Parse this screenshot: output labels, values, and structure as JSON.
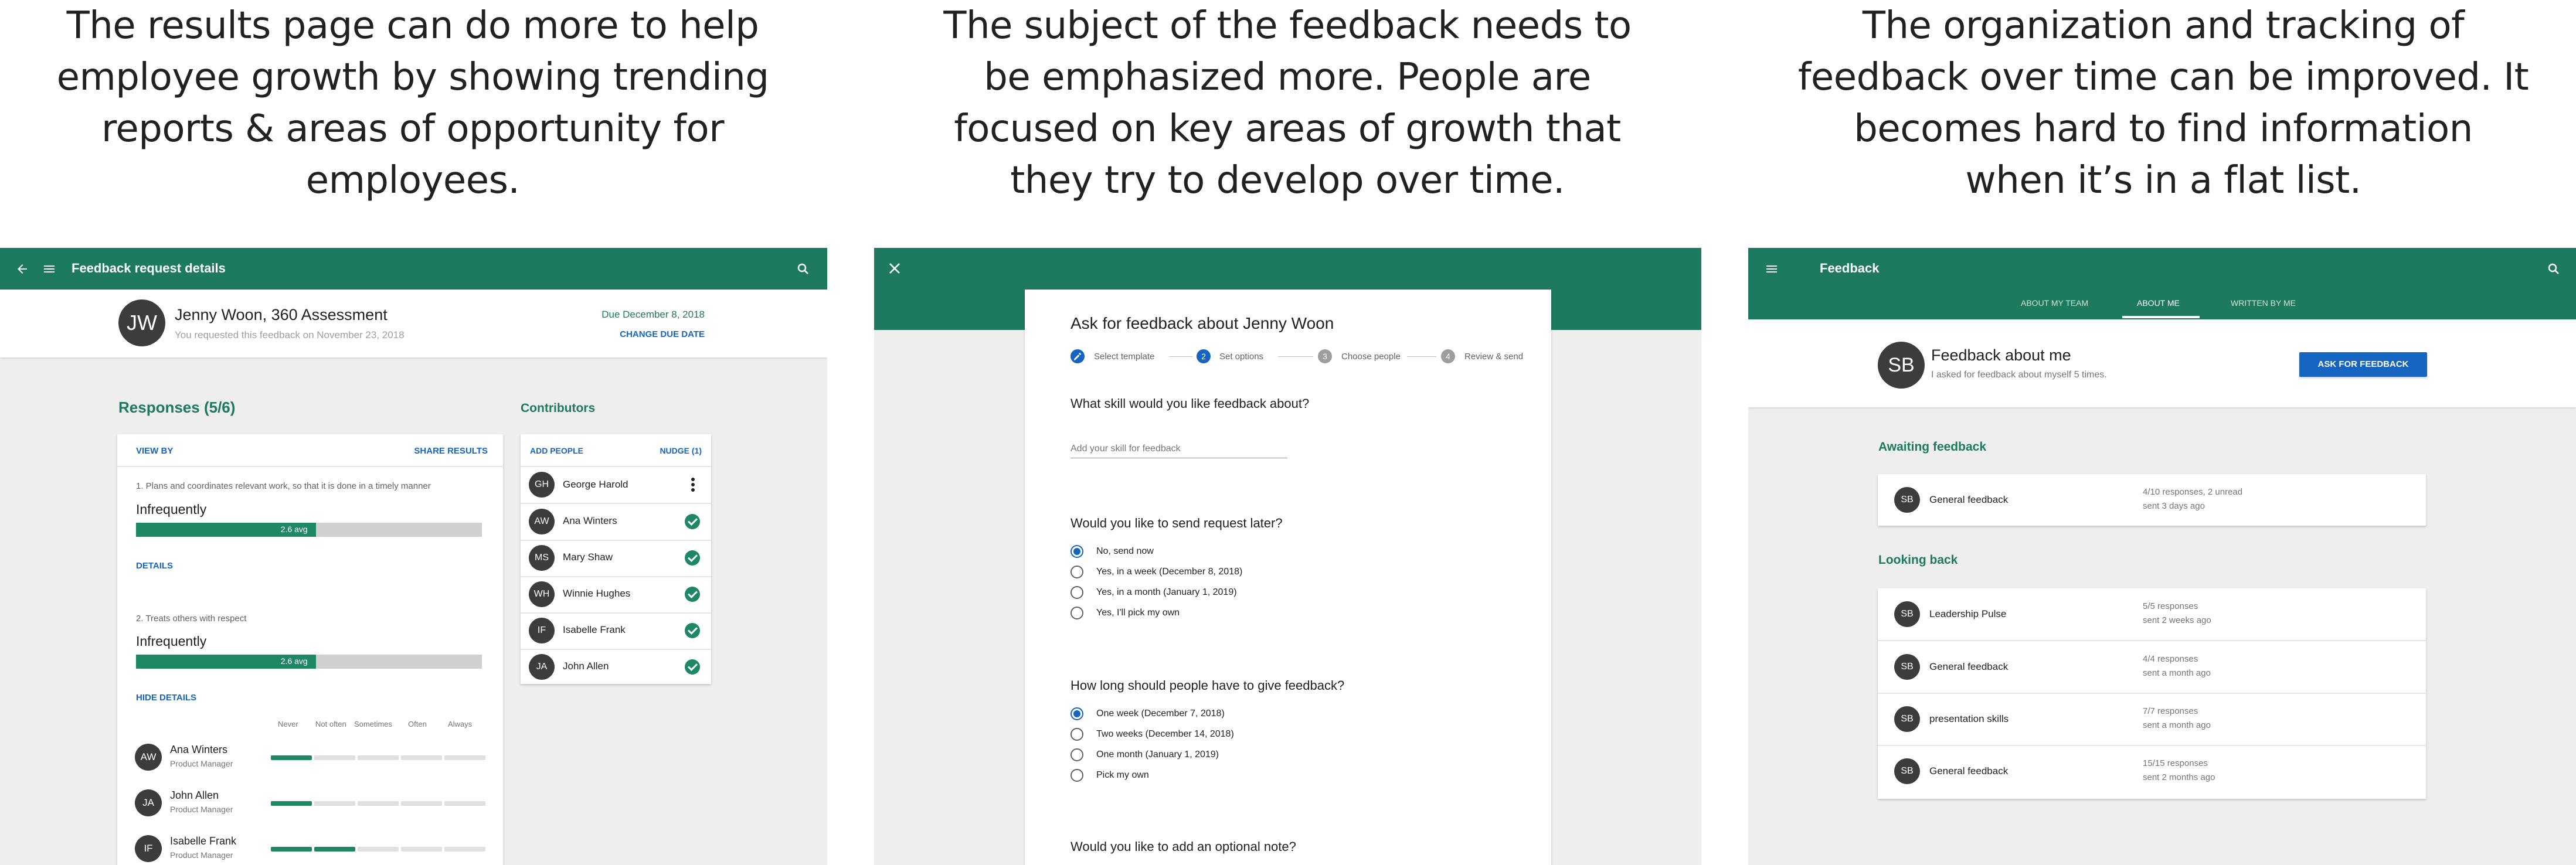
{
  "captions": [
    [
      "The results page can do more to help",
      "employee growth by showing trending",
      "reports & areas of opportunity for",
      "employees."
    ],
    [
      "The subject of the feedback needs to",
      "be emphasized more. People are",
      "focused on key areas of growth that",
      "they try to develop over time."
    ],
    [
      "The organization and tracking of",
      "feedback over time can be improved. It",
      "becomes hard to find information",
      "when it’s in a flat list."
    ]
  ],
  "colors": {
    "primary": "#1d7a5e",
    "accent_blue": "#1565c0",
    "bar_fill": "#1d8766",
    "bar_track": "#d0d0d0",
    "background": "#eeeeee"
  },
  "panel1": {
    "appbar_title": "Feedback request details",
    "icons": [
      "back-arrow-icon",
      "menu-icon",
      "search-icon",
      "more-vert-icon",
      "check-circle-icon"
    ],
    "header": {
      "initials": "JW",
      "title": "Jenny Woon, 360 Assessment",
      "subtitle": "You requested this feedback on November 23, 2018",
      "due": "Due December 8, 2018",
      "change_due": "CHANGE DUE DATE"
    },
    "responses_title": "Responses (5/6)",
    "view_by": "VIEW BY",
    "share_results": "SHARE RESULTS",
    "questions": [
      {
        "text": "1. Plans and coordinates relevant work, so that it is done in a timely manner",
        "rating": "Infrequently",
        "avg_label": "2.6 avg",
        "avg": 2.6,
        "link": "DETAILS"
      },
      {
        "text": "2. Treats others with respect",
        "rating": "Infrequently",
        "avg_label": "2.6 avg",
        "avg": 2.6,
        "link": "HIDE DETAILS"
      }
    ],
    "scale_labels": [
      "Never",
      "Not often",
      "Sometimes",
      "Often",
      "Always"
    ],
    "people": [
      {
        "initials": "AW",
        "name": "Ana Winters",
        "role": "Product Manager",
        "filled_segments": 1
      },
      {
        "initials": "JA",
        "name": "John Allen",
        "role": "Product Manager",
        "filled_segments": 1
      },
      {
        "initials": "IF",
        "name": "Isabelle Frank",
        "role": "Product Manager",
        "filled_segments": 2
      }
    ],
    "contributors_title": "Contributors",
    "add_people": "ADD PEOPLE",
    "nudge": "NUDGE (1)",
    "contributors": [
      {
        "initials": "GH",
        "name": "George Harold",
        "status": "pending"
      },
      {
        "initials": "AW",
        "name": "Ana Winters",
        "status": "done"
      },
      {
        "initials": "MS",
        "name": "Mary Shaw",
        "status": "done"
      },
      {
        "initials": "WH",
        "name": "Winnie Hughes",
        "status": "done"
      },
      {
        "initials": "IF",
        "name": "Isabelle Frank",
        "status": "done"
      },
      {
        "initials": "JA",
        "name": "John Allen",
        "status": "done"
      }
    ]
  },
  "panel2": {
    "icons": [
      "close-icon",
      "edit-icon"
    ],
    "title": "Ask for feedback about Jenny Woon",
    "steps": [
      {
        "num": "",
        "label": "Select template",
        "state": "done"
      },
      {
        "num": "2",
        "label": "Set options",
        "state": "active"
      },
      {
        "num": "3",
        "label": "Choose people",
        "state": "todo"
      },
      {
        "num": "4",
        "label": "Review & send",
        "state": "todo"
      }
    ],
    "skill_question": "What skill would you like feedback about?",
    "skill_placeholder": "Add your skill for feedback",
    "later_question": "Would you like to send request later?",
    "later_options": [
      {
        "label": "No, send now",
        "selected": true
      },
      {
        "label": "Yes, in a week (December 8, 2018)",
        "selected": false
      },
      {
        "label": "Yes, in a month (January 1, 2019)",
        "selected": false
      },
      {
        "label": "Yes, I'll pick my own",
        "selected": false
      }
    ],
    "duration_question": "How long should people have to give feedback?",
    "duration_options": [
      {
        "label": "One week (December 7, 2018)",
        "selected": true
      },
      {
        "label": "Two weeks (December 14, 2018)",
        "selected": false
      },
      {
        "label": "One month (January 1, 2019)",
        "selected": false
      },
      {
        "label": "Pick my own",
        "selected": false
      }
    ],
    "note_question": "Would you like to add an optional note?"
  },
  "panel3": {
    "appbar_title": "Feedback",
    "icons": [
      "menu-icon",
      "search-icon"
    ],
    "tabs": [
      {
        "label": "ABOUT MY TEAM",
        "active": false
      },
      {
        "label": "ABOUT ME",
        "active": true
      },
      {
        "label": "WRITTEN BY ME",
        "active": false
      }
    ],
    "header": {
      "initials": "SB",
      "title": "Feedback about me",
      "subtitle": "I asked for feedback about myself 5 times.",
      "button": "ASK FOR FEEDBACK"
    },
    "awaiting_title": "Awaiting feedback",
    "awaiting": [
      {
        "initials": "SB",
        "name": "General feedback",
        "status": "4/10 responses, 2 unread",
        "sent": "sent 3 days ago"
      }
    ],
    "looking_back_title": "Looking back",
    "looking_back": [
      {
        "initials": "SB",
        "name": "Leadership Pulse",
        "status": "5/5 responses",
        "sent": "sent 2 weeks ago"
      },
      {
        "initials": "SB",
        "name": "General feedback",
        "status": "4/4 responses",
        "sent": "sent a month ago"
      },
      {
        "initials": "SB",
        "name": "presentation skills",
        "status": "7/7 responses",
        "sent": "sent a month ago"
      },
      {
        "initials": "SB",
        "name": "General feedback",
        "status": "15/15 responses",
        "sent": "sent 2 months ago"
      }
    ]
  }
}
